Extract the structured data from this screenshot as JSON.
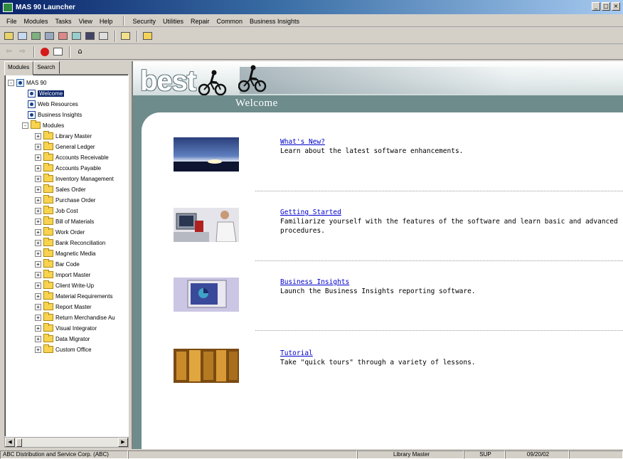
{
  "window": {
    "title": "MAS 90 Launcher",
    "controls": [
      "_",
      "□",
      "×"
    ]
  },
  "menu": [
    "File",
    "Modules",
    "Tasks",
    "View",
    "Help",
    "Security",
    "Utilities",
    "Repair",
    "Common",
    "Business Insights"
  ],
  "left_tabs": [
    "Modules",
    "Search"
  ],
  "tree": {
    "root": "MAS 90",
    "items": [
      {
        "label": "Welcome",
        "selected": true
      },
      {
        "label": "Web Resources"
      },
      {
        "label": "Business Insights"
      }
    ],
    "modules_label": "Modules",
    "modules": [
      "Library Master",
      "General Ledger",
      "Accounts Receivable",
      "Accounts Payable",
      "Inventory Management",
      "Sales Order",
      "Purchase Order",
      "Job Cost",
      "Bill of Materials",
      "Work Order",
      "Bank Reconciliation",
      "Magnetic Media",
      "Bar Code",
      "Import Master",
      "Client Write-Up",
      "Material Requirements",
      "Report Master",
      "Return Merchandise Au",
      "Visual Integrator",
      "Data Migrator",
      "Custom Office"
    ]
  },
  "banner": {
    "logo": "best",
    "heading": "Welcome"
  },
  "content": [
    {
      "link": "What's New?",
      "desc": "Learn about the latest software enhancements.",
      "thumb": "sunset-photo"
    },
    {
      "link": "Getting Started",
      "desc": "Familiarize yourself with the features of the software and learn basic and advanced procedures.",
      "thumb": "person-at-computer-photo"
    },
    {
      "link": "Business Insights",
      "desc": "Launch the Business Insights reporting software.",
      "thumb": "monitor-chart-photo"
    },
    {
      "link": "Tutorial",
      "desc": "Take \"quick tours\" through a variety of lessons.",
      "thumb": "library-shelves-photo"
    }
  ],
  "status": {
    "company": "ABC Distribution and Service Corp. (ABC)",
    "module": "Library Master",
    "user": "SUP",
    "date": "09/20/02"
  },
  "colors": {
    "title_gradient_start": "#0a246a",
    "banner_teal": "#6e8c8c",
    "link": "#0000cc",
    "selection": "#0a246a"
  }
}
